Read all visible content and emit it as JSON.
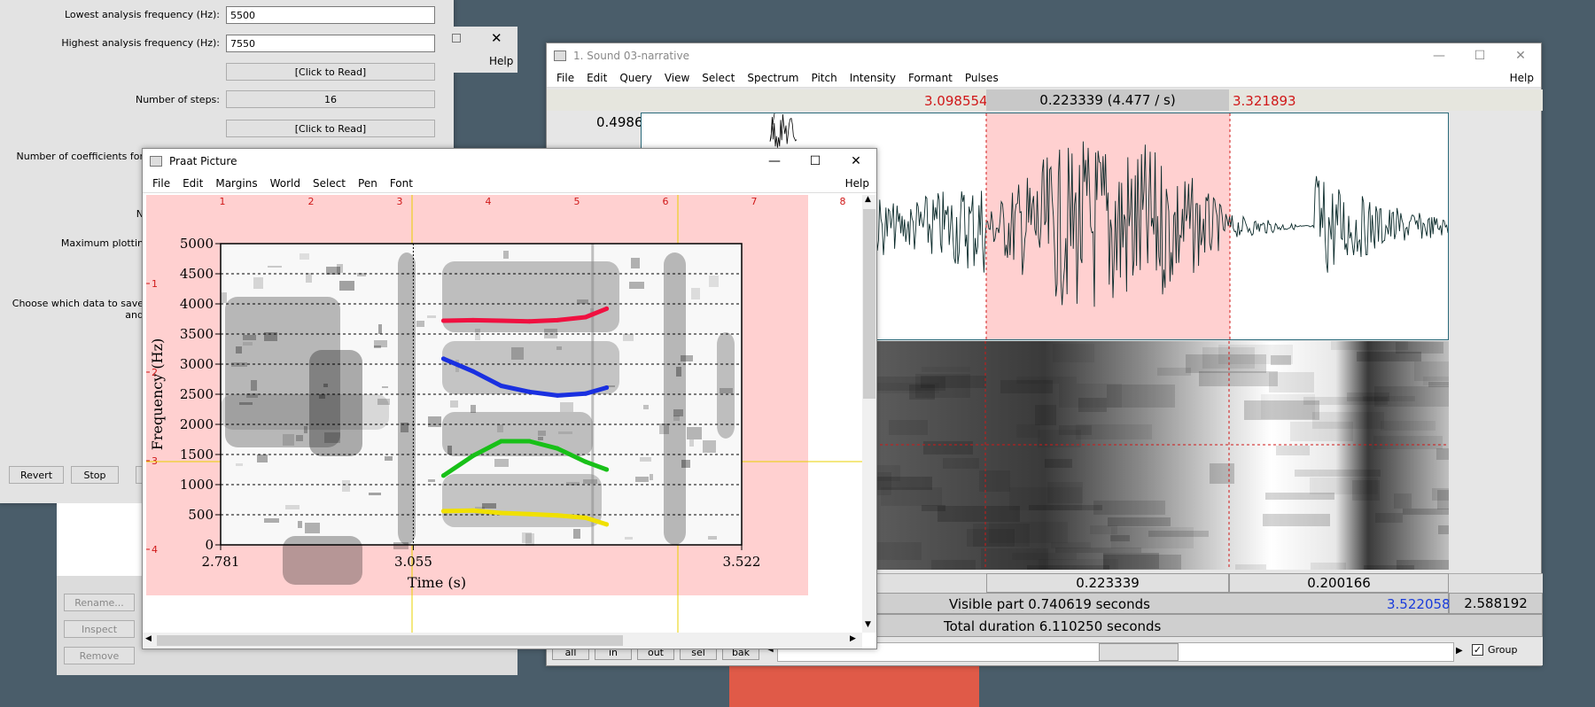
{
  "form": {
    "lowest_label": "Lowest analysis frequency (Hz):",
    "lowest_value": "5500",
    "highest_label": "Highest analysis frequency (Hz):",
    "highest_value": "7550",
    "click_read_1": "[Click to Read]",
    "steps_label": "Number of steps:",
    "steps_value": "16",
    "click_read_2": "[Click to Read]",
    "coeff_label": "Number of coefficients for",
    "n_label": "N",
    "max_plot_label": "Maximum plottin",
    "choose_label": "Choose which data to save and",
    "revert": "Revert",
    "stop": "Stop",
    "help": "Help"
  },
  "objects": {
    "rename": "Rename...",
    "inspect": "Inspect",
    "remove": "Remove"
  },
  "sound_window": {
    "title": "1. Sound 03-narrative",
    "menu": [
      "File",
      "Edit",
      "Query",
      "View",
      "Select",
      "Spectrum",
      "Pitch",
      "Intensity",
      "Formant",
      "Pulses"
    ],
    "help": "Help",
    "sel_start": "3.098554",
    "sel_dur": "0.223339 (4.477 / s)",
    "sel_end": "3.321893",
    "amp_top": "0.4986",
    "seg_mid": "0.223339",
    "seg_right": "0.200166",
    "visible_part": "Visible part 0.740619 seconds",
    "visible_end": "3.522058",
    "right_total": "2.588192",
    "total_duration": "Total duration 6.110250 seconds",
    "buttons": [
      "all",
      "in",
      "out",
      "sel",
      "bak"
    ],
    "group_label": "Group"
  },
  "picture_window": {
    "title": "Praat Picture",
    "menu": [
      "File",
      "Edit",
      "Margins",
      "World",
      "Select",
      "Pen",
      "Font"
    ],
    "help": "Help",
    "ruler_top": [
      "1",
      "2",
      "3",
      "4",
      "5",
      "6",
      "7",
      "8"
    ],
    "ruler_left": [
      "1",
      "2",
      "3",
      "4"
    ]
  },
  "chart_data": {
    "type": "line",
    "xlabel": "Time (s)",
    "ylabel": "Frequency (Hz)",
    "xlim": [
      2.781,
      3.522
    ],
    "ylim": [
      0,
      5000
    ],
    "x_ticks": [
      "2.781",
      "3.055",
      "3.522"
    ],
    "y_ticks": [
      "0",
      "500",
      "1000",
      "1500",
      "2000",
      "2500",
      "3000",
      "3500",
      "4000",
      "4500",
      "5000"
    ],
    "grid": true,
    "series": [
      {
        "color": "#f01040",
        "x": [
          3.098,
          3.14,
          3.18,
          3.22,
          3.26,
          3.3,
          3.33
        ],
        "values": [
          3720,
          3730,
          3720,
          3710,
          3730,
          3780,
          3920
        ]
      },
      {
        "color": "#1a30e0",
        "x": [
          3.098,
          3.14,
          3.18,
          3.22,
          3.26,
          3.3,
          3.33
        ],
        "values": [
          3090,
          2880,
          2640,
          2540,
          2480,
          2510,
          2610
        ]
      },
      {
        "color": "#18c018",
        "x": [
          3.098,
          3.14,
          3.18,
          3.22,
          3.26,
          3.3,
          3.33
        ],
        "values": [
          1150,
          1480,
          1720,
          1720,
          1600,
          1380,
          1250
        ]
      },
      {
        "color": "#f0e000",
        "x": [
          3.098,
          3.14,
          3.18,
          3.22,
          3.26,
          3.3,
          3.33
        ],
        "values": [
          560,
          570,
          530,
          510,
          490,
          450,
          340
        ]
      }
    ]
  },
  "colors": {
    "desktop": "#4a5d6a",
    "selection": "#ffd0d0",
    "waveform": "#0a2a2a"
  }
}
